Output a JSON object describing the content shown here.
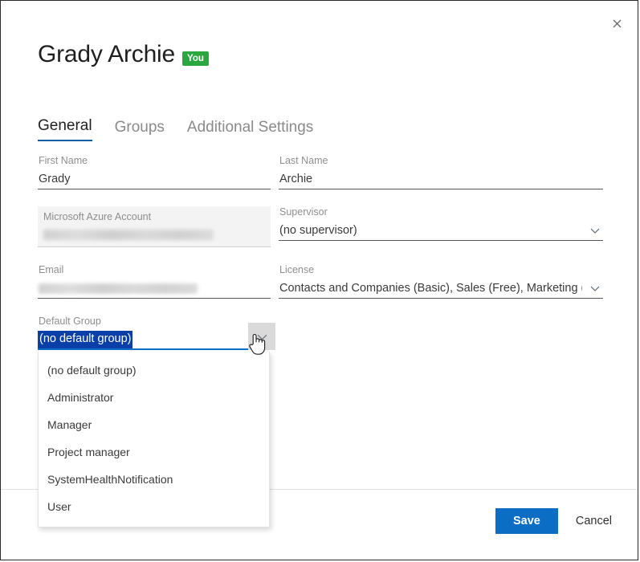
{
  "dialog": {
    "close_icon": "close-icon",
    "title": "Grady Archie",
    "badge": "You"
  },
  "tabs": [
    {
      "label": "General",
      "active": true
    },
    {
      "label": "Groups",
      "active": false
    },
    {
      "label": "Additional Settings",
      "active": false
    }
  ],
  "fields": {
    "first_name": {
      "label": "First Name",
      "value": "Grady"
    },
    "last_name": {
      "label": "Last Name",
      "value": "Archie"
    },
    "azure_account": {
      "label": "Microsoft Azure Account",
      "value": "",
      "redacted": true,
      "disabled": true
    },
    "supervisor": {
      "label": "Supervisor",
      "value": "(no supervisor)",
      "icon": "chevron-down-icon"
    },
    "email": {
      "label": "Email",
      "value": "",
      "redacted": true
    },
    "license": {
      "label": "License",
      "value": "Contacts and Companies (Basic), Sales (Free), Marketing (F...",
      "icon": "chevron-down-icon"
    },
    "default_group": {
      "label": "Default Group",
      "value": "(no default group)",
      "icon": "chevron-down-icon",
      "expanded": true,
      "options": [
        "(no default group)",
        "Administrator",
        "Manager",
        "Project manager",
        "SystemHealthNotification",
        "User"
      ]
    }
  },
  "footer": {
    "save_label": "Save",
    "cancel_label": "Cancel"
  },
  "colors": {
    "accent": "#0b6ec4",
    "badge_green": "#2aa83f",
    "selection_blue": "#0a3ea8",
    "tab_underline": "#0b5fa5"
  }
}
